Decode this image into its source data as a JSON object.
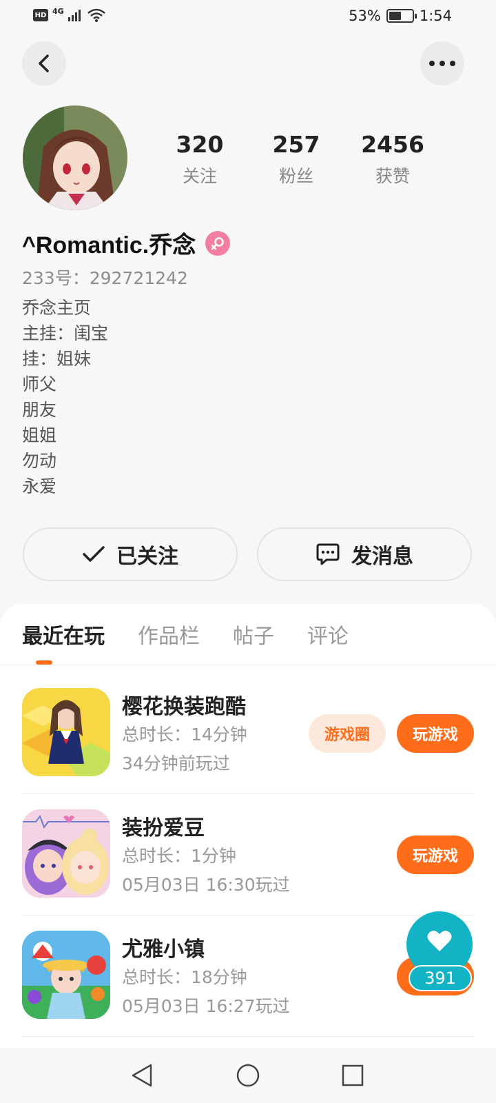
{
  "status_bar": {
    "hd": "HD",
    "network": "4G",
    "battery": "53%",
    "battery_level": 0.53,
    "time": "1:54"
  },
  "header": {
    "back_icon": "chevron-left-icon",
    "more_icon": "more-horizontal-icon"
  },
  "profile": {
    "stats": [
      {
        "value": "320",
        "label": "关注"
      },
      {
        "value": "257",
        "label": "粉丝"
      },
      {
        "value": "2456",
        "label": "获赞"
      }
    ],
    "username": "^Romantic.乔念",
    "gender_icon": "female-icon",
    "gender_color": "#f47ea0",
    "id": "233号：292721242",
    "bio": [
      "乔念主页",
      "主挂：闺宝",
      "挂：姐妹",
      "师父",
      "朋友",
      "姐姐",
      "勿动",
      "永爱"
    ]
  },
  "actions": {
    "follow_label": "已关注",
    "message_label": "发消息"
  },
  "tabs": [
    "最近在玩",
    "作品栏",
    "帖子",
    "评论"
  ],
  "games": [
    {
      "name": "樱花换装跑酷",
      "duration": "总时长：14分钟",
      "last_played": "34分钟前玩过",
      "circle_label": "游戏圈",
      "play_label": "玩游戏"
    },
    {
      "name": "装扮爱豆",
      "duration": "总时长：1分钟",
      "last_played": "05月03日 16:30玩过",
      "play_label": "玩游戏"
    },
    {
      "name": "尤雅小镇",
      "duration": "总时长：18分钟",
      "last_played": "05月03日 16:27玩过",
      "play_label": "玩游戏"
    }
  ],
  "like_fab": {
    "count": "391",
    "icon": "heart-icon",
    "color": "#13b3c6"
  },
  "accent_color": "#ff6d1a",
  "nav": [
    "back-triangle-icon",
    "home-circle-icon",
    "recents-square-icon"
  ]
}
